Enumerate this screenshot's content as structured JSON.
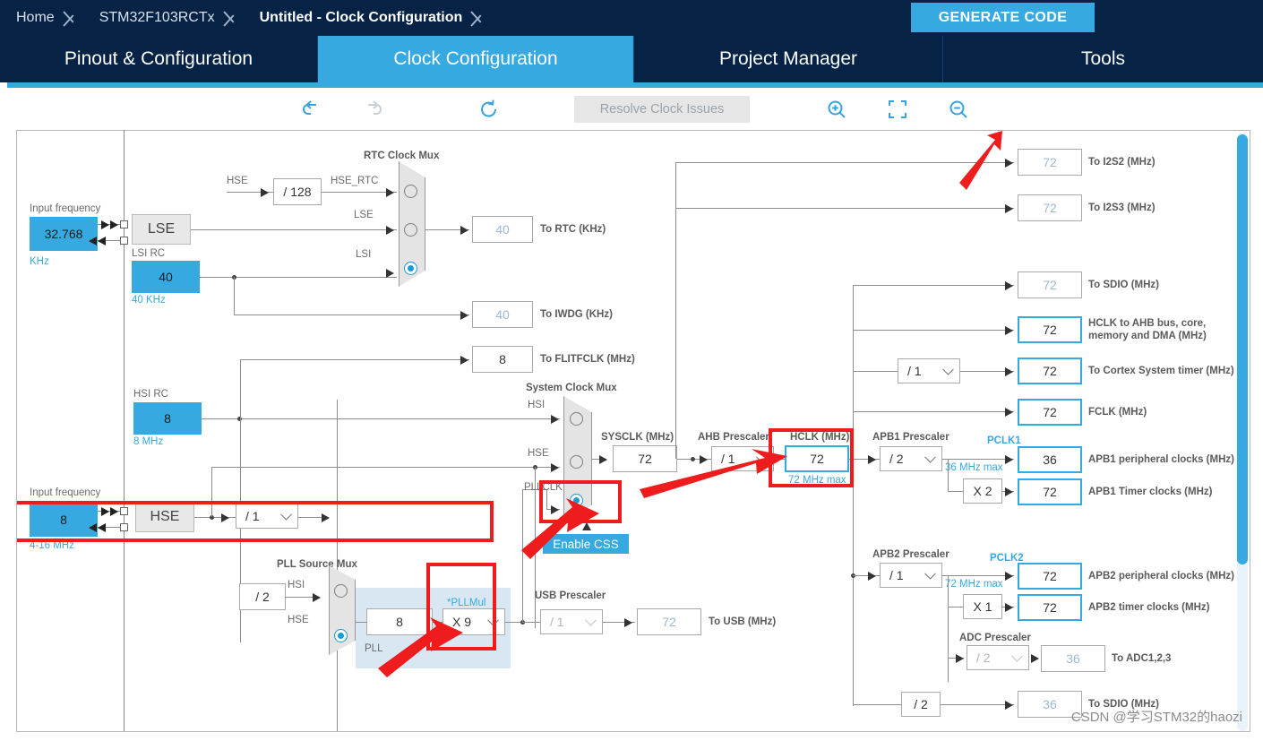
{
  "breadcrumb": {
    "items": [
      {
        "label": "Home",
        "active": false
      },
      {
        "label": "STM32F103RCTx",
        "active": false
      },
      {
        "label": "Untitled - Clock Configuration",
        "active": true
      }
    ]
  },
  "header": {
    "generate_code_label": "GENERATE CODE",
    "accent_color": "#36a9e1",
    "bar_color": "#062346"
  },
  "tabs": [
    {
      "label": "Pinout & Configuration",
      "selected": false
    },
    {
      "label": "Clock Configuration",
      "selected": true
    },
    {
      "label": "Project Manager",
      "selected": false
    },
    {
      "label": "Tools",
      "selected": false
    }
  ],
  "toolbar": {
    "undo_icon": "undo-icon",
    "redo_icon": "redo-icon",
    "reset_icon": "reset-icon",
    "resolve_label": "Resolve Clock Issues",
    "zoom_in_icon": "zoom-in-icon",
    "fit_icon": "fit-to-screen-icon",
    "zoom_out_icon": "zoom-out-icon"
  },
  "diagram": {
    "lse": {
      "input_frequency_label": "Input frequency",
      "value": "32.768",
      "unit_label": "KHz",
      "osc_label": "LSE"
    },
    "lsi": {
      "title": "LSI RC",
      "value": "40",
      "sub_label": "40 KHz"
    },
    "hse_rtc_div": {
      "in_label": "HSE",
      "value": "/ 128",
      "out_label": "HSE_RTC"
    },
    "rtc_mux": {
      "title": "RTC Clock Mux",
      "inputs": [
        "HSE_RTC",
        "LSE",
        "LSI"
      ],
      "selected_index": 2
    },
    "outputs_left": [
      {
        "value": "40",
        "label": "To RTC (KHz)",
        "enabled": false
      },
      {
        "value": "40",
        "label": "To IWDG (KHz)",
        "enabled": false
      },
      {
        "value": "8",
        "label": "To FLITFCLK (MHz)",
        "enabled": true
      }
    ],
    "hsi": {
      "title": "HSI RC",
      "value": "8",
      "sub_label": "8 MHz"
    },
    "hse": {
      "input_frequency_label": "Input frequency",
      "value": "8",
      "unit_label": "4-16 MHz",
      "osc_label": "HSE",
      "divider_value": "/ 1"
    },
    "system_clock_mux": {
      "title": "System Clock Mux",
      "inputs": [
        "HSI",
        "HSE",
        "PLLCLK"
      ],
      "selected_index": 2
    },
    "enable_css_label": "Enable CSS",
    "sysclk": {
      "title": "SYSCLK (MHz)",
      "value": "72"
    },
    "ahb_prescaler": {
      "title": "AHB Prescaler",
      "value": "/ 1"
    },
    "hclk": {
      "title": "HCLK (MHz)",
      "value": "72",
      "max_label": "72 MHz max"
    },
    "apb1_prescaler": {
      "title": "APB1 Prescaler",
      "value": "/ 2"
    },
    "pclk1": {
      "title": "PCLK1",
      "max_label": "36 MHz max"
    },
    "apb1_timer_mul": {
      "value": "X 2"
    },
    "apb2_prescaler": {
      "title": "APB2 Prescaler",
      "value": "/ 1"
    },
    "pclk2": {
      "title": "PCLK2",
      "max_label": "72 MHz max"
    },
    "apb2_timer_mul": {
      "value": "X 1"
    },
    "adc_prescaler": {
      "title": "ADC Prescaler",
      "value": "/ 2"
    },
    "sdio_div": {
      "value": "/ 2"
    },
    "cortex_prescaler": {
      "value": "/ 1"
    },
    "pll_source_mux": {
      "title": "PLL Source Mux",
      "inputs": [
        "HSI",
        "HSE"
      ],
      "selected_index": 1,
      "hsi_div_value": "/ 2",
      "pll_input_value": "8",
      "pll_label": "PLL"
    },
    "pllmul": {
      "title": "*PLLMul",
      "value": "X 9"
    },
    "usb_prescaler": {
      "title": "USB Prescaler",
      "value": "/ 1"
    },
    "usb_output": {
      "value": "72",
      "label": "To USB (MHz)"
    },
    "outputs_right": [
      {
        "value": "72",
        "label": "To I2S2 (MHz)",
        "enabled": false
      },
      {
        "value": "72",
        "label": "To I2S3 (MHz)",
        "enabled": false
      },
      {
        "value": "72",
        "label": "To SDIO (MHz)",
        "enabled": false
      },
      {
        "value": "72",
        "label": "HCLK to AHB bus, core,\nmemory and DMA (MHz)",
        "enabled": true
      },
      {
        "value": "72",
        "label": "To Cortex System timer (MHz)",
        "enabled": true
      },
      {
        "value": "72",
        "label": "FCLK (MHz)",
        "enabled": true
      },
      {
        "value": "36",
        "label": "APB1 peripheral clocks (MHz)",
        "enabled": true
      },
      {
        "value": "72",
        "label": "APB1 Timer clocks (MHz)",
        "enabled": true
      },
      {
        "value": "72",
        "label": "APB2 peripheral clocks (MHz)",
        "enabled": true
      },
      {
        "value": "72",
        "label": "APB2 timer clocks (MHz)",
        "enabled": true
      },
      {
        "value": "36",
        "label": "To ADC1,2,3",
        "enabled": false
      },
      {
        "value": "36",
        "label": "To SDIO (MHz)",
        "enabled": false
      }
    ]
  },
  "watermark": "CSDN @学习STM32的haozi"
}
